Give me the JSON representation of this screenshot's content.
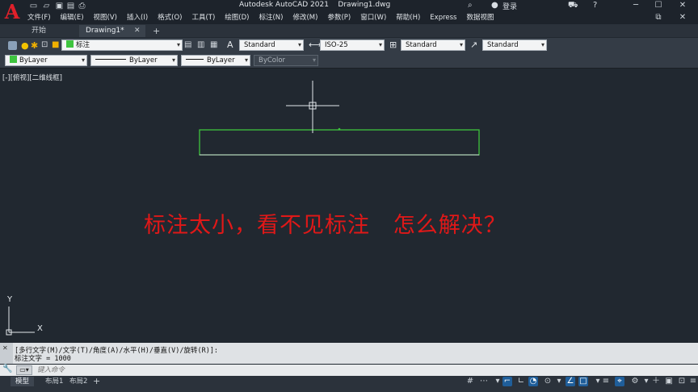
{
  "titlebar": {
    "logo": "A",
    "app_title": "Autodesk AutoCAD 2021    Drawing1.dwg",
    "login": "登录",
    "quick_access": [
      "new-icon",
      "open-icon",
      "save-icon",
      "saveas-icon",
      "print-icon",
      "undo-icon",
      "redo-icon"
    ]
  },
  "menu": [
    "文件(F)",
    "编辑(E)",
    "视图(V)",
    "插入(I)",
    "格式(O)",
    "工具(T)",
    "绘图(D)",
    "标注(N)",
    "修改(M)",
    "参数(P)",
    "窗口(W)",
    "帮助(H)",
    "Express",
    "数据视图"
  ],
  "tabs": {
    "start": "开始",
    "drawing": "Drawing1*",
    "add": "+"
  },
  "toolbar1": {
    "layer": "标注",
    "text_style": "Standard",
    "dim_style": "ISO-25",
    "table_style": "Standard",
    "mleader_style": "Standard"
  },
  "toolbar2": {
    "color": "ByLayer",
    "linetype": "ByLayer",
    "lineweight": "ByLayer",
    "plotstyle": "ByColor"
  },
  "view_label": "[-][俯视][二维线框]",
  "overlay_text": "标注太小，看不见标注   怎么解决？",
  "ucs": {
    "y": "Y",
    "x": "X"
  },
  "command": {
    "history1": "[多行文字(M)/文字(T)/角度(A)/水平(H)/垂直(V)/旋转(R)]:",
    "history2": "标注文字 = 1000",
    "placeholder": "键入命令"
  },
  "layout_tabs": [
    "模型",
    "布局1",
    "布局2"
  ],
  "colors": {
    "accent_red": "#e01818",
    "rect_green": "#3ec43e",
    "canvas": "#212830"
  }
}
